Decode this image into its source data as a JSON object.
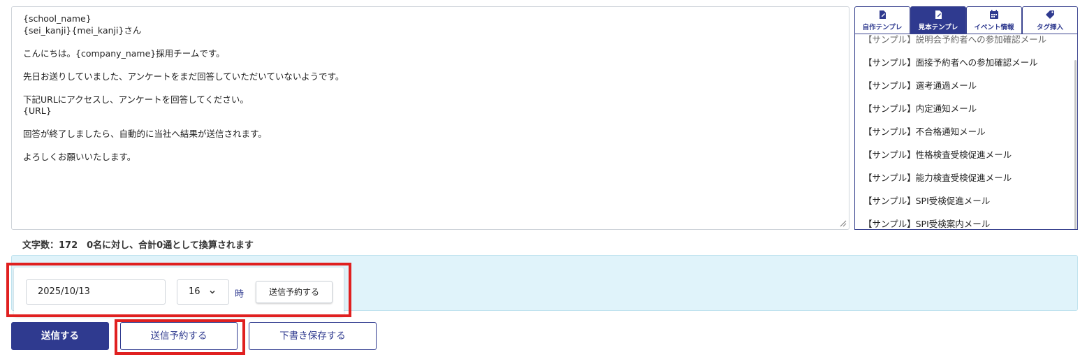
{
  "editor": {
    "lines": [
      "{school_name}",
      "{sei_kanji}{mei_kanji}さん",
      "",
      "こんにちは。{company_name}採用チームです。",
      "",
      "先日お送りしていました、アンケートをまだ回答していただいていないようです。",
      "",
      "下記URLにアクセスし、アンケートを回答してください。",
      "{URL}",
      "",
      "回答が終了しましたら、自動的に当社へ結果が送信されます。",
      "",
      "よろしくお願いいたします。"
    ]
  },
  "tabs": [
    {
      "label": "自作テンプレ",
      "icon": "template-edit-icon",
      "active": false
    },
    {
      "label": "見本テンプレ",
      "icon": "template-sample-icon",
      "active": true
    },
    {
      "label": "イベント情報",
      "icon": "calendar-icon",
      "active": false
    },
    {
      "label": "タグ挿入",
      "icon": "tag-icon",
      "active": false
    }
  ],
  "templates": {
    "partial_first": "【サンプル】説明会予約者への参加確認メール",
    "items": [
      "【サンプル】面接予約者への参加確認メール",
      "【サンプル】選考通過メール",
      "【サンプル】内定通知メール",
      "【サンプル】不合格通知メール",
      "【サンプル】性格検査受検促進メール",
      "【サンプル】能力検査受検促進メール",
      "【サンプル】SPI受検促進メール",
      "【サンプル】SPI受検案内メール"
    ]
  },
  "status": {
    "char_count": "文字数：172　0名に対し、合計0通として換算されます"
  },
  "schedule": {
    "date_value": "2025/10/13",
    "hour_value": "16",
    "hour_unit": "時",
    "reserve_label": "送信予約する"
  },
  "actions": {
    "send_label": "送信する",
    "reserve_label": "送信予約する",
    "draft_label": "下書き保存する"
  },
  "colors": {
    "primary": "#2f3a8f",
    "band": "#e0f3fa",
    "highlight": "#e02020"
  }
}
